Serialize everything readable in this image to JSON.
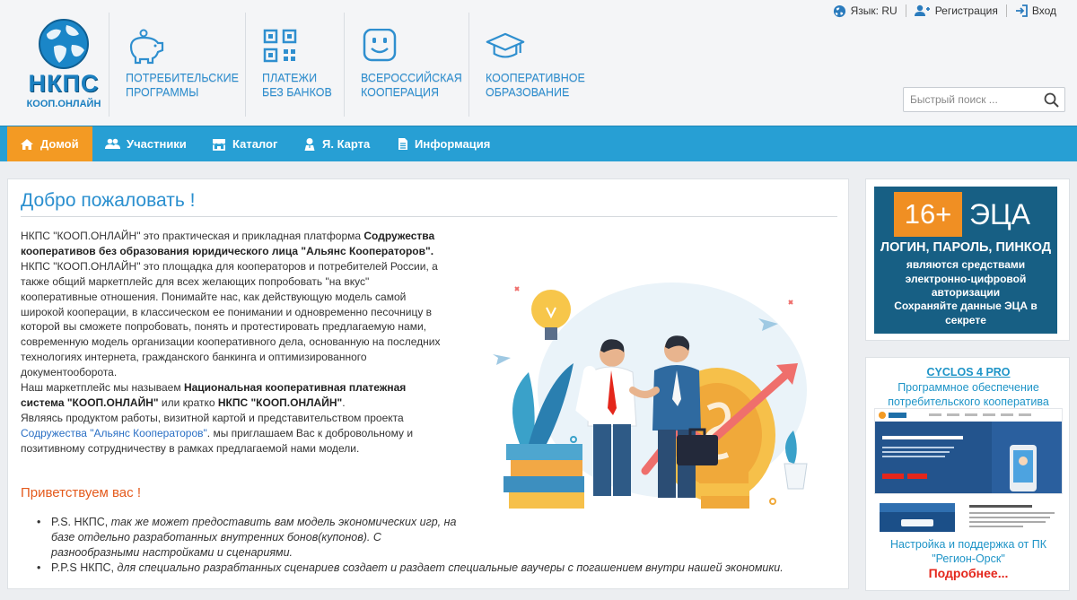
{
  "brand": {
    "abbr": "НКПС",
    "sub": "КООП.ОНЛАЙН"
  },
  "top_nav": [
    {
      "label": "ПОТРЕБИТЕЛЬСКИЕ ПРОГРАММЫ",
      "icon": "piggy-bank-icon",
      "line1": "ПОТРЕБИТЕЛЬСКИЕ",
      "line2": "ПРОГРАММЫ"
    },
    {
      "label": "ПЛАТЕЖИ БЕЗ БАНКОВ",
      "icon": "qr-code-icon",
      "line1": "ПЛАТЕЖИ",
      "line2": "БЕЗ БАНКОВ"
    },
    {
      "label": "ВСЕРОССИЙСКАЯ КООПЕРАЦИЯ",
      "icon": "smile-icon",
      "line1": "ВСЕРОССИЙСКАЯ",
      "line2": "КООПЕРАЦИЯ"
    },
    {
      "label": "КООПЕРАТИВНОЕ ОБРАЗОВАНИЕ",
      "icon": "graduation-cap-icon",
      "line1": "КООПЕРАТИВНОЕ",
      "line2": "ОБРАЗОВАНИЕ"
    }
  ],
  "top_links": {
    "language": "Язык: RU",
    "register": "Регистрация",
    "login": "Вход"
  },
  "search": {
    "placeholder": "Быстрый поиск ..."
  },
  "menu": [
    {
      "label": "Домой",
      "icon": "home-icon",
      "active": true
    },
    {
      "label": "Участники",
      "icon": "users-icon",
      "active": false
    },
    {
      "label": "Каталог",
      "icon": "store-icon",
      "active": false
    },
    {
      "label": "Я. Карта",
      "icon": "map-marker-icon",
      "active": false
    },
    {
      "label": "Информация",
      "icon": "document-icon",
      "active": false
    }
  ],
  "main": {
    "title": "Добро пожаловать !",
    "p1_a": "НКПС \"КООП.ОНЛАЙН\" это практическая и прикладная платформа ",
    "p1_b": "Содружества кооперативов без образования юридического лица \"Альянс Кооператоров\".",
    "p2": "НКПС \"КООП.ОНЛАЙН\" это площадка для кооператоров и потребителей России, а также общий маркетплейс для всех желающих попробовать \"на вкус\" кооперативные отношения. Понимайте нас, как действующую модель самой широкой кооперации, в классическом ее понимании и одновременно песочницу в которой вы сможете попробовать, понять и протестировать предлагаемую нами, современную модель организации кооперативного дела, основанную на последних технологиях интернета, гражданского банкинга и оптимизированного документооборота.",
    "p3_a": "Наш маркетплейс мы называем ",
    "p3_b": "Национальная кооперативная платежная система \"КООП.ОНЛАЙН\"",
    "p3_c": " или кратко ",
    "p3_d": "НКПС \"КООП.ОНЛАЙН\"",
    "p3_e": ".",
    "p4_a": "Являясь продуктом работы, визитной картой и  представительством проекта ",
    "p4_link": "Содружества \"Альянс Кооператоров\"",
    "p4_b": ". мы приглашаем Вас к добровольному и позитивному сотрудничеству в рамках предлагаемой нами модели.",
    "greeting": "Приветствуем вас !",
    "ps1_label": "P.S.",
    "ps1_a": " НКПС, ",
    "ps1_b": "так же может предоставить вам модель экономических игр, на базе отдельно разработанных внутренних бонов(купонов). С разнообразными настройками и сценариями.",
    "ps2_label": "P.P.S",
    "ps2_a": " НКПС, ",
    "ps2_b": "для специально разрабтанных сценариев создает и раздает специальные ваучеры с погашением внутри нашей экономики."
  },
  "side_banner": {
    "age": "16+",
    "eca": "ЭЦА",
    "line1": "ЛОГИН, ПАРОЛЬ, ПИНКОД",
    "line2": "являются средствами электронно-цифровой авторизации",
    "line3": "Сохраняйте данные ЭЦА в секрете"
  },
  "cyclos": {
    "title": "CYCLOS 4 PRO",
    "desc": "Программное обеспечение потребительского кооператива",
    "setup": "Настройка и поддержка от ПК \"Регион-Орск\"",
    "more": "Подробнее..."
  },
  "colors": {
    "accent": "#279fd4",
    "active_tab": "#f39a23",
    "brand_blue": "#1a7fc0",
    "link_blue": "#1e94c7",
    "greeting": "#e45a1c",
    "more_red": "#e4261b"
  }
}
